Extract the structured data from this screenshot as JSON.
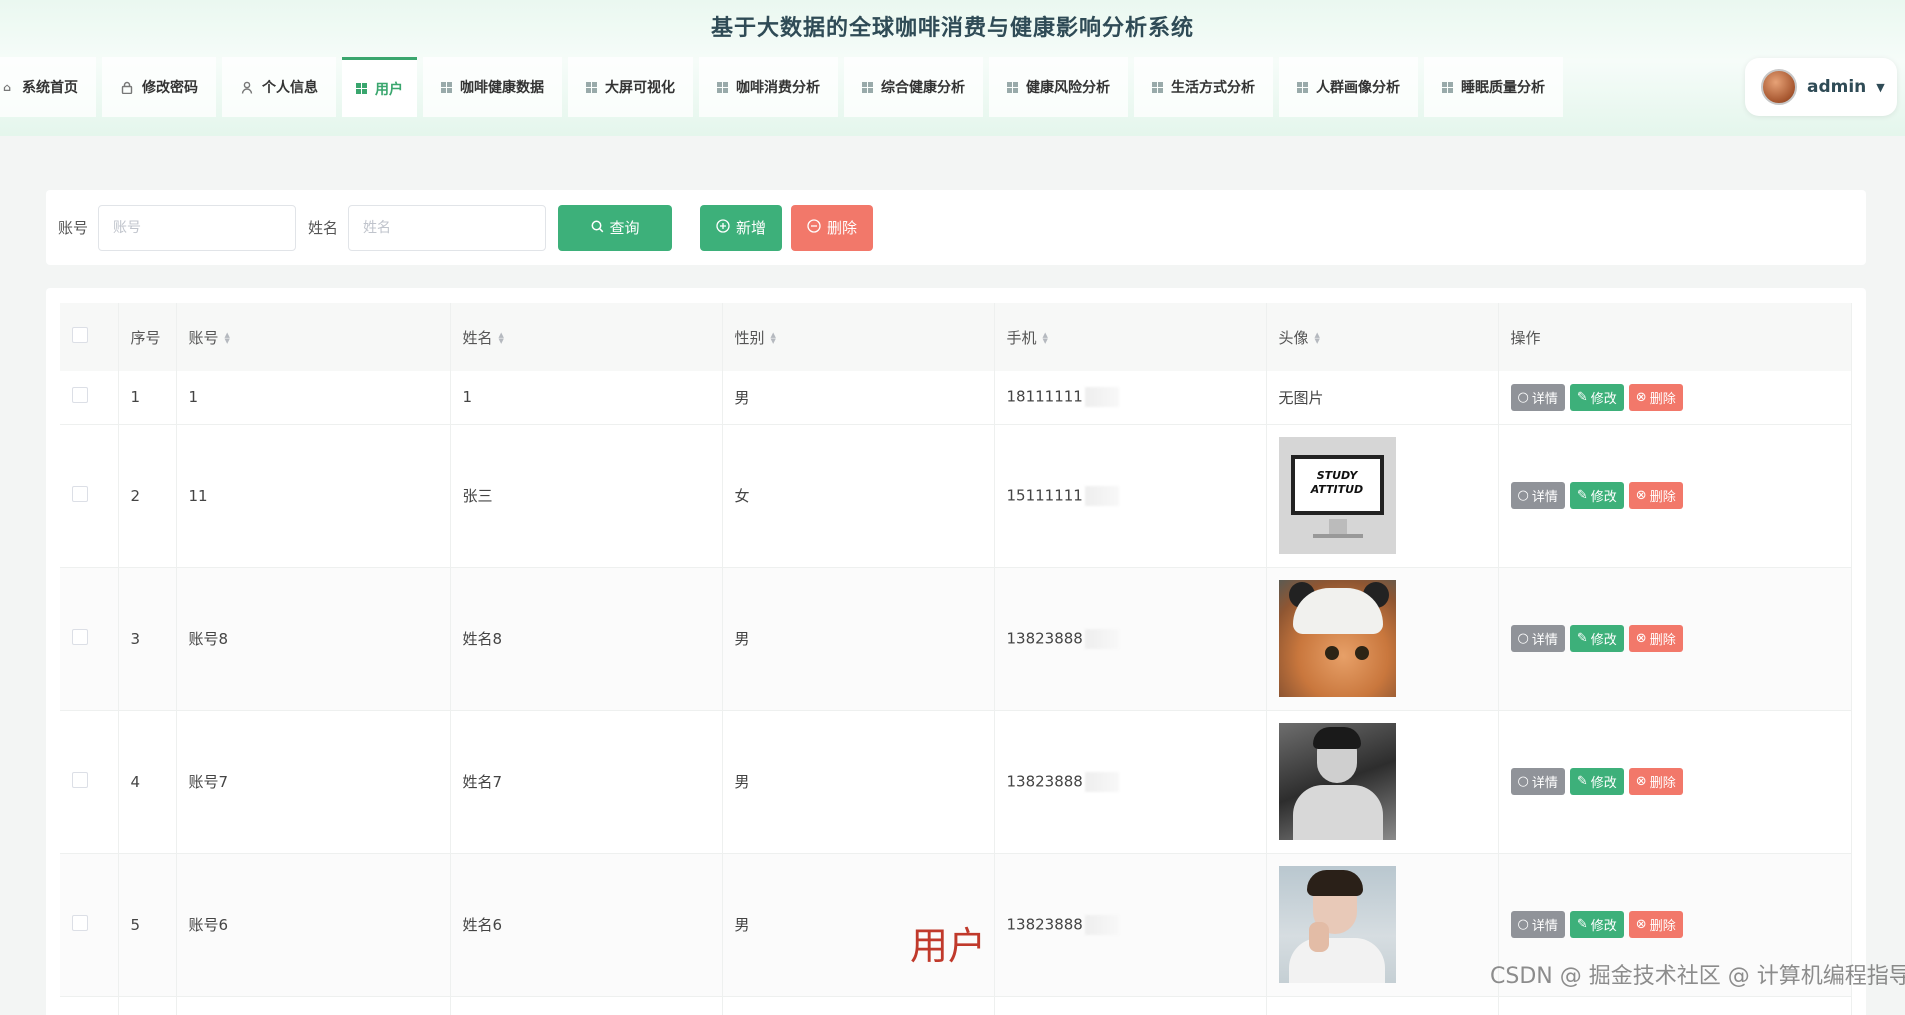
{
  "header": {
    "title": "基于大数据的全球咖啡消费与健康影响分析系统",
    "nav": [
      {
        "label": "系统首页",
        "icon": "home-icon"
      },
      {
        "label": "修改密码",
        "icon": "lock-icon"
      },
      {
        "label": "个人信息",
        "icon": "user-icon"
      },
      {
        "label": "用户",
        "icon": "grid-icon",
        "active": true
      },
      {
        "label": "咖啡健康数据",
        "icon": "grid-icon"
      },
      {
        "label": "大屏可视化",
        "icon": "grid-icon"
      },
      {
        "label": "咖啡消费分析",
        "icon": "grid-icon"
      },
      {
        "label": "综合健康分析",
        "icon": "grid-icon"
      },
      {
        "label": "健康风险分析",
        "icon": "grid-icon"
      },
      {
        "label": "生活方式分析",
        "icon": "grid-icon"
      },
      {
        "label": "人群画像分析",
        "icon": "grid-icon"
      },
      {
        "label": "睡眠质量分析",
        "icon": "grid-icon"
      }
    ],
    "user": {
      "name": "admin"
    }
  },
  "search": {
    "account_label": "账号",
    "account_placeholder": "账号",
    "name_label": "姓名",
    "name_placeholder": "姓名",
    "query_label": "查询",
    "add_label": "新增",
    "delete_label": "删除"
  },
  "table": {
    "columns": [
      "序号",
      "账号",
      "姓名",
      "性别",
      "手机",
      "头像",
      "操作"
    ],
    "rows": [
      {
        "index": "1",
        "account": "1",
        "name": "1",
        "gender": "男",
        "phone": "18111111",
        "avatar": "无图片"
      },
      {
        "index": "2",
        "account": "11",
        "name": "张三",
        "gender": "女",
        "phone": "15111111",
        "avatar": "study-attitude-image"
      },
      {
        "index": "3",
        "account": "账号8",
        "name": "姓名8",
        "gender": "男",
        "phone": "13823888",
        "avatar": "cat-image"
      },
      {
        "index": "4",
        "account": "账号7",
        "name": "姓名7",
        "gender": "男",
        "phone": "13823888",
        "avatar": "man-coat-image"
      },
      {
        "index": "5",
        "account": "账号6",
        "name": "姓名6",
        "gender": "男",
        "phone": "13823888",
        "avatar": "man-portrait-image"
      }
    ],
    "ops": {
      "detail": "详情",
      "edit": "修改",
      "delete": "删除"
    },
    "thumb_text": [
      "STUDY",
      "ATTITUD"
    ]
  },
  "overlay": {
    "caption": "用户",
    "watermark": "CSDN @ 掘金技术社区 @ 计算机编程指导师"
  },
  "colors": {
    "primary": "#3db07a",
    "danger": "#f2786a",
    "info": "#909399",
    "title": "#2f4b56"
  }
}
